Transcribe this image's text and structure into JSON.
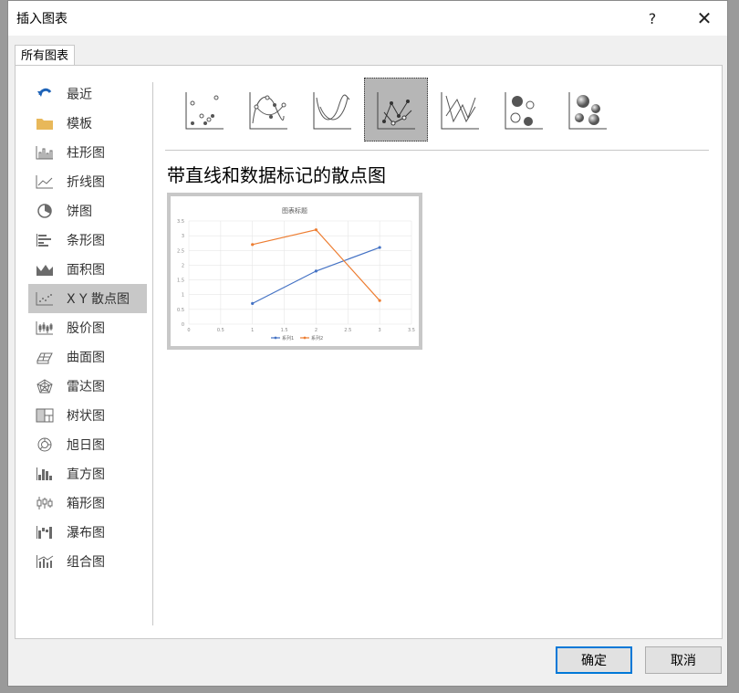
{
  "dialog": {
    "title": "插入图表",
    "help_label": "?",
    "close_label": "✕",
    "tab_all_charts": "所有图表"
  },
  "nav": {
    "items": [
      {
        "label": "最近",
        "icon": "recent-icon"
      },
      {
        "label": "模板",
        "icon": "folder-icon"
      },
      {
        "label": "柱形图",
        "icon": "column-chart-icon"
      },
      {
        "label": "折线图",
        "icon": "line-chart-icon"
      },
      {
        "label": "饼图",
        "icon": "pie-chart-icon"
      },
      {
        "label": "条形图",
        "icon": "bar-chart-icon"
      },
      {
        "label": "面积图",
        "icon": "area-chart-icon"
      },
      {
        "label": "X Y 散点图",
        "icon": "scatter-chart-icon",
        "selected": true
      },
      {
        "label": "股价图",
        "icon": "stock-chart-icon"
      },
      {
        "label": "曲面图",
        "icon": "surface-chart-icon"
      },
      {
        "label": "雷达图",
        "icon": "radar-chart-icon"
      },
      {
        "label": "树状图",
        "icon": "treemap-chart-icon"
      },
      {
        "label": "旭日图",
        "icon": "sunburst-chart-icon"
      },
      {
        "label": "直方图",
        "icon": "histogram-chart-icon"
      },
      {
        "label": "箱形图",
        "icon": "box-whisker-chart-icon"
      },
      {
        "label": "瀑布图",
        "icon": "waterfall-chart-icon"
      },
      {
        "label": "组合图",
        "icon": "combo-chart-icon"
      }
    ]
  },
  "subtypes": [
    {
      "icon": "scatter-markers-only-icon"
    },
    {
      "icon": "scatter-smooth-lines-markers-icon"
    },
    {
      "icon": "scatter-smooth-lines-icon"
    },
    {
      "icon": "scatter-straight-lines-markers-icon",
      "selected": true
    },
    {
      "icon": "scatter-straight-lines-icon"
    },
    {
      "icon": "bubble-icon"
    },
    {
      "icon": "bubble-3d-icon"
    }
  ],
  "selected_subtype_title": "带直线和数据标记的散点图",
  "chart_data": {
    "type": "scatter",
    "title": "图表标题",
    "xlim": [
      0,
      3.5
    ],
    "ylim": [
      0,
      3.5
    ],
    "x_ticks": [
      "0",
      "0.5",
      "1",
      "1.5",
      "2",
      "2.5",
      "3",
      "3.5"
    ],
    "y_ticks": [
      "0",
      "0.5",
      "1",
      "1.5",
      "2",
      "2.5",
      "3",
      "3.5"
    ],
    "grid": true,
    "legend": "bottom",
    "series": [
      {
        "name": "系列1",
        "color": "#4472c4",
        "points": [
          [
            1,
            0.7
          ],
          [
            2,
            1.8
          ],
          [
            3,
            2.6
          ]
        ]
      },
      {
        "name": "系列2",
        "color": "#ed7d31",
        "points": [
          [
            1,
            2.7
          ],
          [
            2,
            3.2
          ],
          [
            3,
            0.8
          ]
        ]
      }
    ]
  },
  "footer": {
    "ok_label": "确定",
    "cancel_label": "取消"
  }
}
